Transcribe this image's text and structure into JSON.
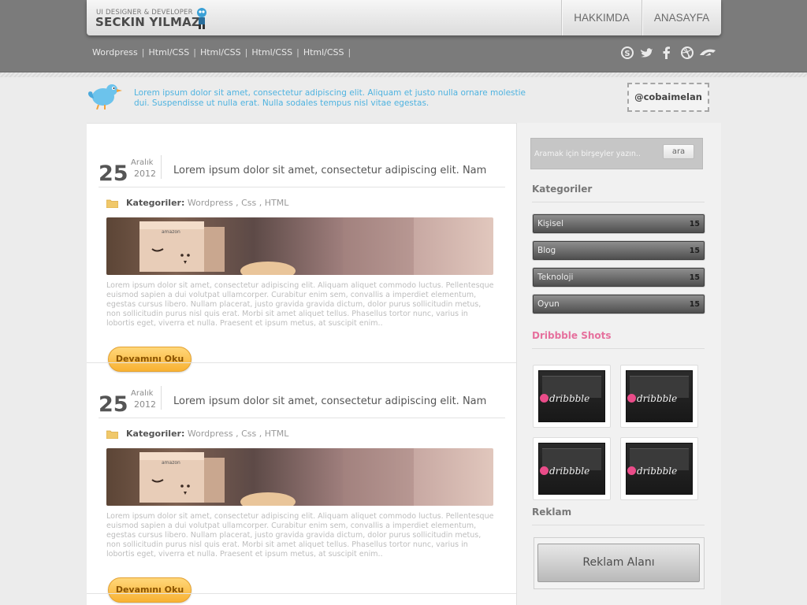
{
  "header": {
    "logo_tagline": "UI DESIGNER & DEVELOPER",
    "logo_name": "SECKIN YILMAZ",
    "nav": {
      "about": "HAKKIMDA",
      "home": "ANASAYFA"
    }
  },
  "subnav": {
    "items": [
      "Wordpress",
      "Html/CSS",
      "Html/CSS",
      "Html/CSS",
      "Html/CSS"
    ]
  },
  "social": [
    "skype-icon",
    "twitter-icon",
    "facebook-icon",
    "dribbble-icon",
    "deviantart-icon"
  ],
  "twitter": {
    "tweet": "Lorem ipsum dolor sit amet, consectetur adipiscing elit. Aliquam et justo nulla ornare molestie dui. Suspendisse ut nulla erat. Nulla sodales tempus nisl vitae egestas.",
    "handle": "@cobaimelan"
  },
  "posts": [
    {
      "day": "25",
      "month": "Aralık",
      "year": "2012",
      "title": "Lorem ipsum dolor sit amet, consectetur adipiscing elit. Nam",
      "category_label": "Kategoriler:",
      "categories": "Wordpress , Css , HTML",
      "excerpt": "Lorem ipsum dolor sit amet, consectetur adipiscing elit. Aliquam aliquet commodo luctus. Pellentesque euismod sapien a dui volutpat ullamcorper. Curabitur enim sem, convallis a imperdiet elementum, egestas cursus libero. Nullam placerat, justo gravida gravida dictum, dolor purus sollicitudin metus, non sollicitudin purus nisl quis erat. Morbi sit amet aliquet tellus. Phasellus tortor nunc, varius in lobortis eget, viverra et nulla. Praesent et ipsum metus, at suscipit enim..",
      "read_more": "Devamını Oku"
    },
    {
      "day": "25",
      "month": "Aralık",
      "year": "2012",
      "title": "Lorem ipsum dolor sit amet, consectetur adipiscing elit. Nam",
      "category_label": "Kategoriler:",
      "categories": "Wordpress , Css , HTML",
      "excerpt": "Lorem ipsum dolor sit amet, consectetur adipiscing elit. Aliquam aliquet commodo luctus. Pellentesque euismod sapien a dui volutpat ullamcorper. Curabitur enim sem, convallis a imperdiet elementum, egestas cursus libero. Nullam placerat, justo gravida gravida dictum, dolor purus sollicitudin metus, non sollicitudin purus nisl quis erat. Morbi sit amet aliquet tellus. Phasellus tortor nunc, varius in lobortis eget, viverra et nulla. Praesent et ipsum metus, at suscipit enim..",
      "read_more": "Devamını Oku"
    }
  ],
  "sidebar": {
    "search": {
      "placeholder": "Aramak için birşeyler yazın..",
      "button": "ara"
    },
    "categories_heading": "Kategoriler",
    "categories": [
      {
        "name": "Kişisel",
        "count": "15"
      },
      {
        "name": "Blog",
        "count": "15"
      },
      {
        "name": "Teknoloji",
        "count": "15"
      },
      {
        "name": "Oyun",
        "count": "15"
      }
    ],
    "dribbble_heading": "Dribbble Shots",
    "shot_label": "dribbble",
    "ad_heading": "Reklam",
    "ad_label": "Reklam Alanı"
  },
  "colors": {
    "accent_blue": "#4fb3e0",
    "dribbble_pink": "#e6709d",
    "button_orange": "#f8b233"
  }
}
